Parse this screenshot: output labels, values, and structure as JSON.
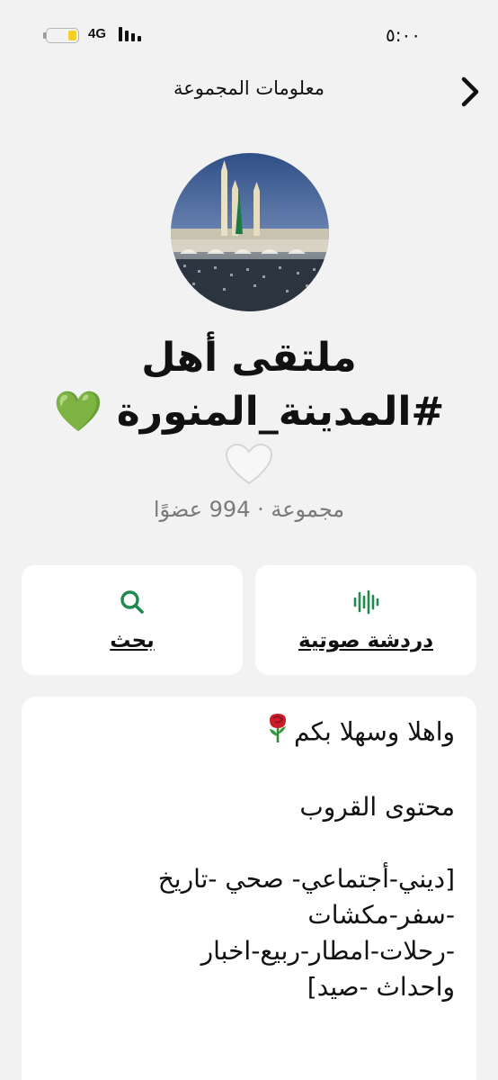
{
  "status_bar": {
    "network": "4G",
    "time": "٥:٠٠",
    "battery_level": 0.3
  },
  "nav": {
    "title": "معلومات المجموعة"
  },
  "group": {
    "title_line1": "ملتقى أهل",
    "title_line2": "#المدينة_المنورة 💚",
    "title_line3": "🤍",
    "subtitle": "مجموعة · 994 عضوًا"
  },
  "actions": {
    "voice_chat_label": "دردشة صوتية",
    "search_label": "بحث"
  },
  "description": {
    "lines": [
      "واهلا وسهلا بكم",
      "",
      "محتوى القروب",
      "",
      "[ديني-أجتماعي- صحي -تاريخ",
      "-سفر-مكشات",
      "-رحلات-امطار-ربيع-اخبار",
      "واحداث -صيد]"
    ]
  },
  "colors": {
    "accent_green": "#1f8a4c",
    "battery_yellow": "#f4cf2a"
  }
}
